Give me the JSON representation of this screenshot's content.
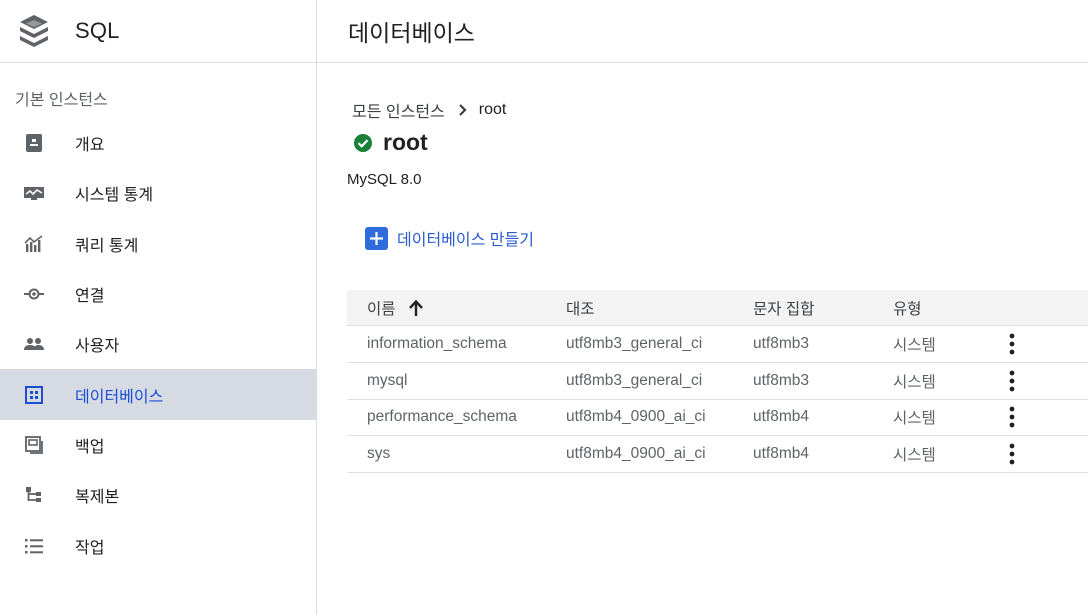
{
  "app": {
    "title": "SQL",
    "icon": "sql-stack-icon"
  },
  "sidebar": {
    "section_title": "기본 인스턴스",
    "items": [
      {
        "label": "개요",
        "icon": "overview-icon",
        "active": false
      },
      {
        "label": "시스템 통계",
        "icon": "system-stats-icon",
        "active": false
      },
      {
        "label": "쿼리 통계",
        "icon": "query-stats-icon",
        "active": false
      },
      {
        "label": "연결",
        "icon": "connection-icon",
        "active": false
      },
      {
        "label": "사용자",
        "icon": "users-icon",
        "active": false
      },
      {
        "label": "데이터베이스",
        "icon": "database-icon",
        "active": true
      },
      {
        "label": "백업",
        "icon": "backup-icon",
        "active": false
      },
      {
        "label": "복제본",
        "icon": "replica-icon",
        "active": false
      },
      {
        "label": "작업",
        "icon": "operations-icon",
        "active": false
      }
    ]
  },
  "header": {
    "title": "데이터베이스"
  },
  "breadcrumb": {
    "parent": "모든 인스턴스",
    "current": "root"
  },
  "instance": {
    "name": "root",
    "version": "MySQL 8.0",
    "status_icon": "check-circle-icon"
  },
  "actions": {
    "create_database": "데이터베이스 만들기"
  },
  "table": {
    "columns": [
      "이름",
      "대조",
      "문자 집합",
      "유형"
    ],
    "sort_column": "이름",
    "rows": [
      {
        "name": "information_schema",
        "collation": "utf8mb3_general_ci",
        "charset": "utf8mb3",
        "type": "시스템"
      },
      {
        "name": "mysql",
        "collation": "utf8mb3_general_ci",
        "charset": "utf8mb3",
        "type": "시스템"
      },
      {
        "name": "performance_schema",
        "collation": "utf8mb4_0900_ai_ci",
        "charset": "utf8mb4",
        "type": "시스템"
      },
      {
        "name": "sys",
        "collation": "utf8mb4_0900_ai_ci",
        "charset": "utf8mb4",
        "type": "시스템"
      }
    ]
  },
  "colors": {
    "accent": "#1a4fd6",
    "active_bg": "#d6dae3",
    "success": "#188038",
    "button_blue": "#2f6bdb"
  }
}
